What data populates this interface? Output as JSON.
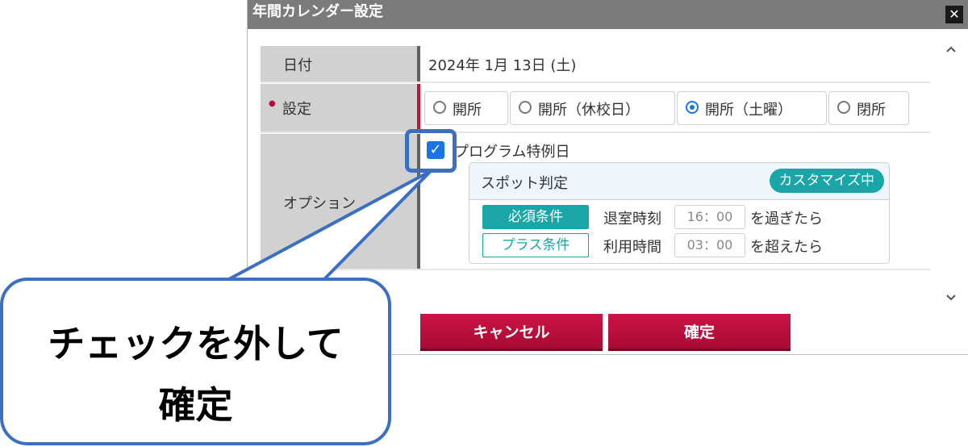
{
  "dialog": {
    "title": "年間カレンダー設定",
    "close_glyph": "✕"
  },
  "form": {
    "date_label": "日付",
    "date_value": "2024年 1月 13日 (土)",
    "setting_label": "設定",
    "required_mark": "●",
    "radio_options": [
      {
        "label": "開所",
        "selected": false
      },
      {
        "label": "開所（休校日）",
        "selected": false
      },
      {
        "label": "開所（土曜）",
        "selected": true
      },
      {
        "label": "閉所",
        "selected": false
      }
    ],
    "option_label": "オプション",
    "program_special_day": {
      "label": "プログラム特例日",
      "checked": true
    },
    "spot": {
      "title": "スポット判定",
      "badge": "カスタマイズ中",
      "required_condition": {
        "tag": "必須条件",
        "label": "退室時刻",
        "time": "16：00",
        "suffix": "を過ぎたら"
      },
      "plus_condition": {
        "tag": "プラス条件",
        "label": "利用時間",
        "time": "03：00",
        "suffix": "を超えたら"
      }
    }
  },
  "buttons": {
    "cancel": "キャンセル",
    "confirm": "確定"
  },
  "scroll": {
    "up_icon": "chevron-up-icon",
    "down_icon": "chevron-down-icon"
  },
  "callout": {
    "line1": "チェックを外して",
    "line2": "確定"
  },
  "colors": {
    "accent_blue": "#1a73e8",
    "teal": "#1aa6a8",
    "button_red": "#b80d3b",
    "callout_border": "#3b6fc6"
  }
}
